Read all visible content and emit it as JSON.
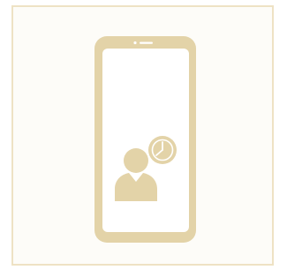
{
  "illustration": {
    "icon": "phone-with-user-and-clock",
    "colors": {
      "frame_border": "#eee2c4",
      "frame_fill": "#fdfcf8",
      "phone": "#e3d3a8",
      "screen": "#ffffff",
      "person": "#e3d3a8",
      "clock": "#e3d3a8",
      "clock_hands": "#ffffff"
    }
  }
}
